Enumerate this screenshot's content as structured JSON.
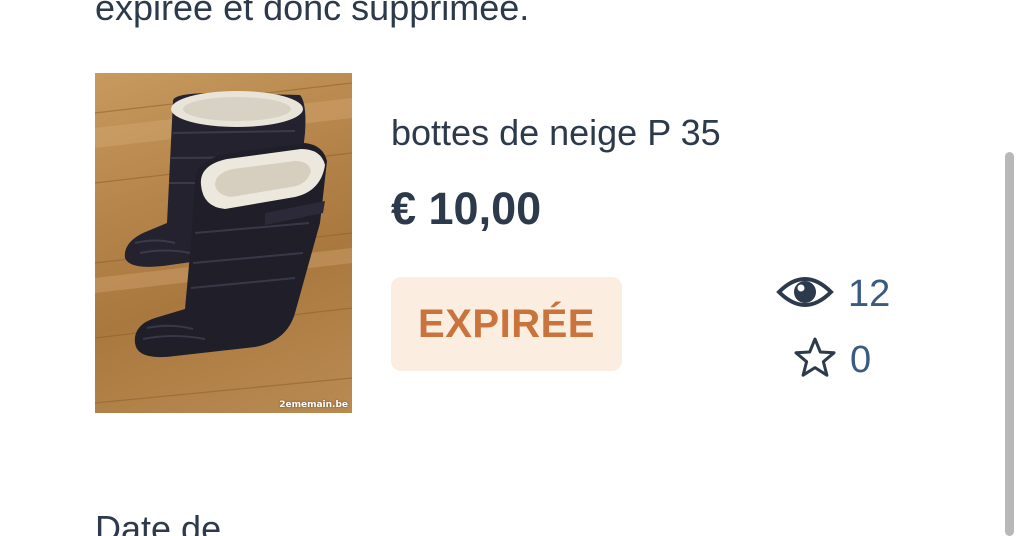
{
  "notice": {
    "text": "expirée et donc supprimée."
  },
  "listing": {
    "thumbnail_watermark": "2ememain.be",
    "title": "bottes de neige P 35",
    "price": "€ 10,00",
    "status_badge": "EXPIRÉE",
    "views_count": "12",
    "favorites_count": "0"
  },
  "details": {
    "date_label": "Date de"
  },
  "icons": {
    "views": "eye-icon",
    "favorites": "star-outline-icon"
  },
  "colors": {
    "text": "#2c3a4b",
    "badge_background": "#fbeee0",
    "badge_text": "#c8743c",
    "count_text": "#3a5a82",
    "scrollbar": "#b8b8b8"
  }
}
